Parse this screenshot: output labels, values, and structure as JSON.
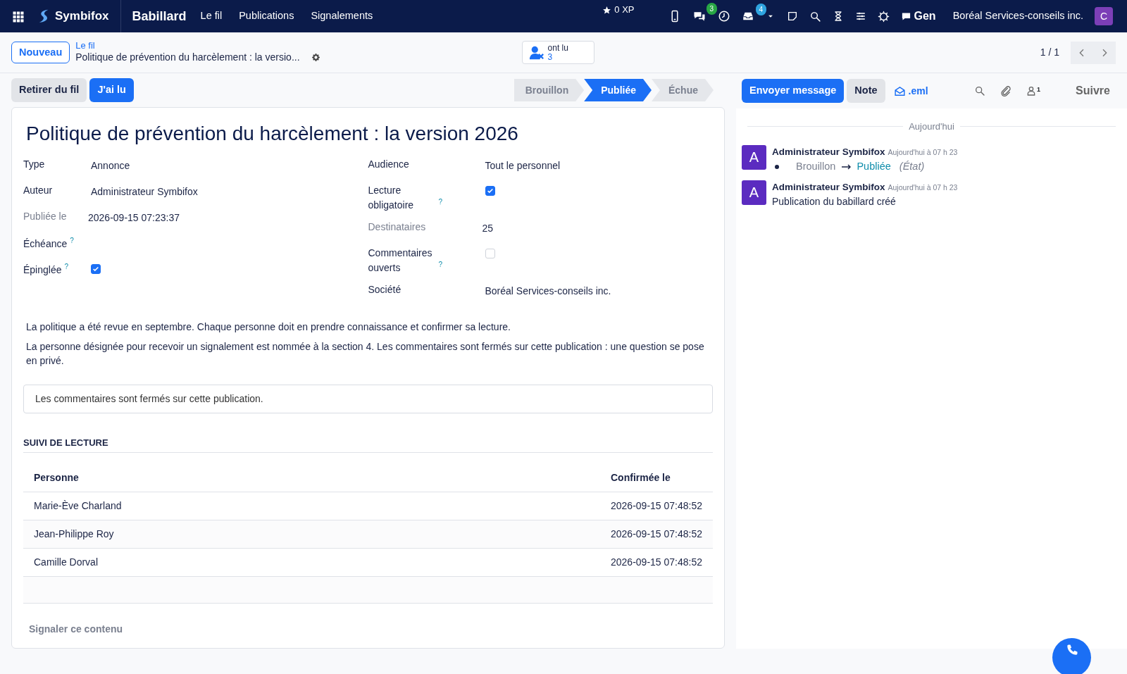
{
  "navbar": {
    "brand": "Symbifox",
    "module": "Babillard",
    "menu": [
      "Le fil",
      "Publications",
      "Signalements"
    ],
    "xp": "0 XP",
    "chat_count": "3",
    "activity_count": "4",
    "chat_label": "Gen",
    "company": "Boréal Services-conseils inc.",
    "user_initial": "C"
  },
  "control_panel": {
    "new_button": "Nouveau",
    "breadcrumb": "Le fil",
    "record_title": "Politique de prévention du harcèlement : la versio...",
    "readers_label": "ont lu",
    "readers_count": "3",
    "pager": "1 / 1"
  },
  "actions": [
    {
      "label": "Retirer du fil",
      "kind": "secondary"
    },
    {
      "label": "J'ai lu",
      "kind": "primary"
    }
  ],
  "stages": [
    {
      "label": "Brouillon",
      "selected": false
    },
    {
      "label": "Publiée",
      "selected": true
    },
    {
      "label": "Échue",
      "selected": false
    }
  ],
  "form": {
    "title": "Politique de prévention du harcèlement : la version 2026",
    "left_fields": [
      {
        "label": "Type",
        "kind": "text",
        "value": "Annonce"
      },
      {
        "label": "Auteur",
        "kind": "text",
        "value": "Administrateur Symbifox"
      },
      {
        "label": "Publiée le",
        "kind": "text",
        "value": "2026-09-15 07:23:37",
        "readonly": true
      },
      {
        "label": "Échéance",
        "kind": "empty",
        "help": "?"
      },
      {
        "label": "Épinglée",
        "kind": "checkbox",
        "help": "?",
        "checked": true
      }
    ],
    "right_fields": [
      {
        "label": "Audience",
        "kind": "text",
        "value": "Tout le personnel"
      },
      {
        "label": "Lecture obligatoire",
        "kind": "checkbox",
        "help": "?",
        "checked": true
      },
      {
        "label": "Destinataires",
        "kind": "text",
        "value": "25",
        "readonly": true
      },
      {
        "label": "Commentaires ouverts",
        "kind": "checkbox",
        "help": "?",
        "checked": false
      },
      {
        "label": "Société",
        "kind": "text",
        "value": "Boréal Services-conseils inc."
      }
    ],
    "body": [
      "La politique a été revue en septembre. Chaque personne doit en prendre connaissance et confirmer sa lecture.",
      "La personne désignée pour recevoir un signalement est nommée à la section 4. Les commentaires sont fermés sur cette publication : une question se pose en privé."
    ],
    "notice": "Les commentaires sont fermés sur cette publication.",
    "section_title": "SUIVI DE LECTURE",
    "table": {
      "columns": [
        "Personne",
        "Confirmée le"
      ],
      "rows": [
        [
          "Marie-Ève Charland",
          "2026-09-15 07:48:52"
        ],
        [
          "Jean-Philippe Roy",
          "2026-09-15 07:48:52"
        ],
        [
          "Camille Dorval",
          "2026-09-15 07:48:52"
        ]
      ]
    },
    "report_link": "Signaler ce contenu"
  },
  "chatter": {
    "send_button": "Envoyer message",
    "note_button": "Note",
    "eml": ".eml",
    "followers_count": "1",
    "follow": "Suivre",
    "date_separator": "Aujourd'hui",
    "messages": [
      {
        "avatar": "A",
        "author": "Administrateur Symbifox",
        "time": "Aujourd'hui à 07 h 23",
        "kind": "tracking",
        "old": "Brouillon",
        "new": "Publiée",
        "field": "(État)"
      },
      {
        "avatar": "A",
        "author": "Administrateur Symbifox",
        "time": "Aujourd'hui à 07 h 23",
        "kind": "text",
        "body": "Publication du babillard créé"
      }
    ]
  }
}
